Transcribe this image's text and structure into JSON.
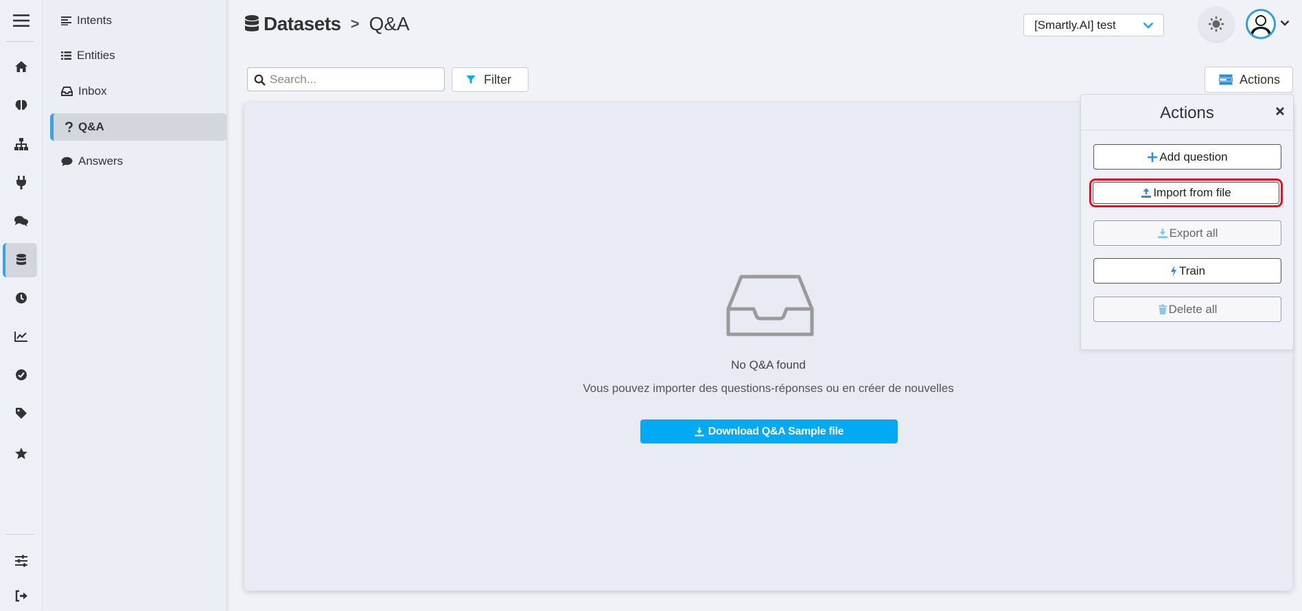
{
  "rail": {
    "icons": [
      "menu-icon",
      "home-icon",
      "brain-icon",
      "sitemap-icon",
      "plug-icon",
      "chat-icon",
      "database-icon",
      "clock-icon",
      "chart-icon",
      "check-circle-icon",
      "tag-icon",
      "star-icon",
      "sliders-icon",
      "logout-icon"
    ],
    "active": "database-icon"
  },
  "sidebar": {
    "items": [
      {
        "label": "Intents",
        "icon": "align-left-icon"
      },
      {
        "label": "Entities",
        "icon": "list-icon"
      },
      {
        "label": "Inbox",
        "icon": "inbox-icon"
      },
      {
        "label": "Q&A",
        "icon": "question-icon"
      },
      {
        "label": "Answers",
        "icon": "comment-icon"
      }
    ],
    "active": "Q&A"
  },
  "header": {
    "breadcrumb_root": "Datasets",
    "breadcrumb_sep": ">",
    "breadcrumb_leaf": "Q&A",
    "project": "[Smartly.AI] test"
  },
  "toolbar": {
    "search_placeholder": "Search...",
    "filter_label": "Filter",
    "actions_label": "Actions"
  },
  "empty_state": {
    "title": "No Q&A found",
    "subtitle": "Vous pouvez importer des questions-réponses ou en créer de nouvelles",
    "download_label": "Download Q&A Sample file"
  },
  "actions_panel": {
    "title": "Actions",
    "buttons": [
      {
        "label": "Add question",
        "icon": "plus-icon",
        "enabled": true
      },
      {
        "label": "Import from file",
        "icon": "upload-icon",
        "enabled": true,
        "highlighted": true
      },
      {
        "label": "Export all",
        "icon": "download-icon",
        "enabled": false
      },
      {
        "label": "Train",
        "icon": "bolt-icon",
        "enabled": true
      },
      {
        "label": "Delete all",
        "icon": "trash-icon",
        "enabled": false
      }
    ]
  },
  "colors": {
    "accent": "#02a9f4",
    "active_bar": "#3aa0e8",
    "highlight": "#e0141e"
  }
}
